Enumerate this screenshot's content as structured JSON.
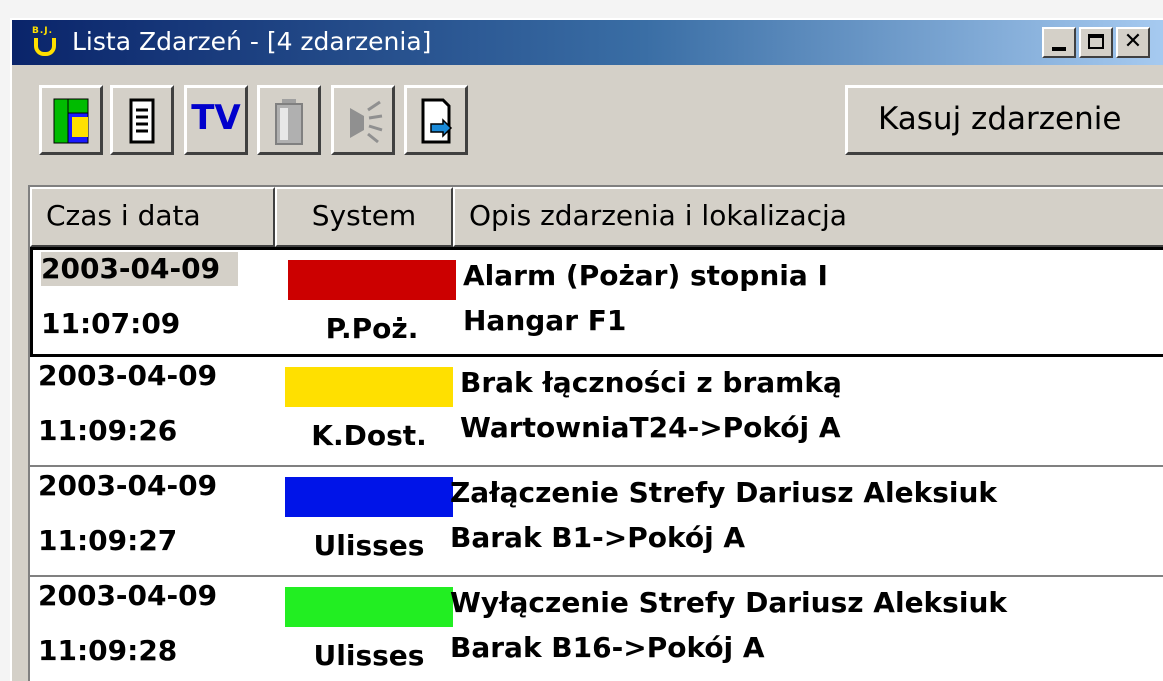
{
  "window": {
    "title": "Lista Zdarzeń - [4 zdarzenia]",
    "app_icon": "magnet-icon",
    "app_icon_caption": "B.J."
  },
  "toolbar": {
    "buttons": [
      {
        "icon": "layout-icon"
      },
      {
        "icon": "document-list-icon"
      },
      {
        "icon": "tv-icon",
        "label": "TV"
      },
      {
        "icon": "battery-icon"
      },
      {
        "icon": "alarm-icon"
      },
      {
        "icon": "report-icon"
      }
    ],
    "delete_label": "Kasuj zdarzenie"
  },
  "table": {
    "columns": [
      "Czas i data",
      "System",
      "Opis zdarzenia i lokalizacja"
    ],
    "rows": [
      {
        "date": "2003-04-09",
        "time": "11:07:09",
        "color": "#cc0000",
        "system": "P.Poż.",
        "desc1": "Alarm (Pożar) stopnia I",
        "desc2": "Hangar F1",
        "selected": true
      },
      {
        "date": "2003-04-09",
        "time": "11:09:26",
        "color": "#ffe000",
        "system": "K.Dost.",
        "desc1": "Brak łączności z bramką",
        "desc2": "WartowniaT24->Pokój A",
        "selected": false
      },
      {
        "date": "2003-04-09",
        "time": "11:09:27",
        "color": "#0014e8",
        "system": "Ulisses",
        "desc1": "Załączenie Strefy Dariusz Aleksiuk",
        "desc2": "Barak B1->Pokój A",
        "selected": false
      },
      {
        "date": "2003-04-09",
        "time": "11:09:28",
        "color": "#22ee22",
        "system": "Ulisses",
        "desc1": "Wyłączenie Strefy Dariusz Aleksiuk",
        "desc2": "Barak B16->Pokój A",
        "selected": false
      }
    ]
  }
}
